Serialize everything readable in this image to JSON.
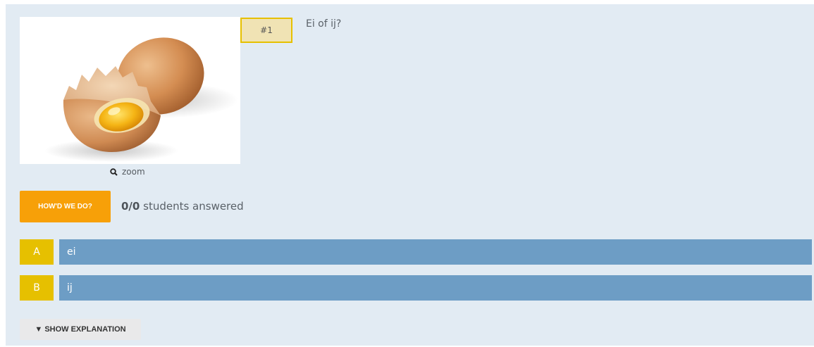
{
  "question": {
    "number": "#1",
    "text": "Ei of ij?",
    "image_icon": "egg-image",
    "zoom_label": "zoom",
    "zoom_icon": "magnifier-icon"
  },
  "stats": {
    "button_label": "HOW'D WE DO?",
    "answered_count": "0/0",
    "answered_suffix": " students answered"
  },
  "choices": [
    {
      "letter": "A",
      "text": "ei"
    },
    {
      "letter": "B",
      "text": "ij"
    }
  ],
  "explanation": {
    "button_label": "▼ SHOW EXPLANATION"
  },
  "colors": {
    "panel_bg": "#e2ebf3",
    "accent_orange": "#f7a008",
    "letter_yellow": "#e6c000",
    "choice_blue": "#6d9dc5"
  }
}
